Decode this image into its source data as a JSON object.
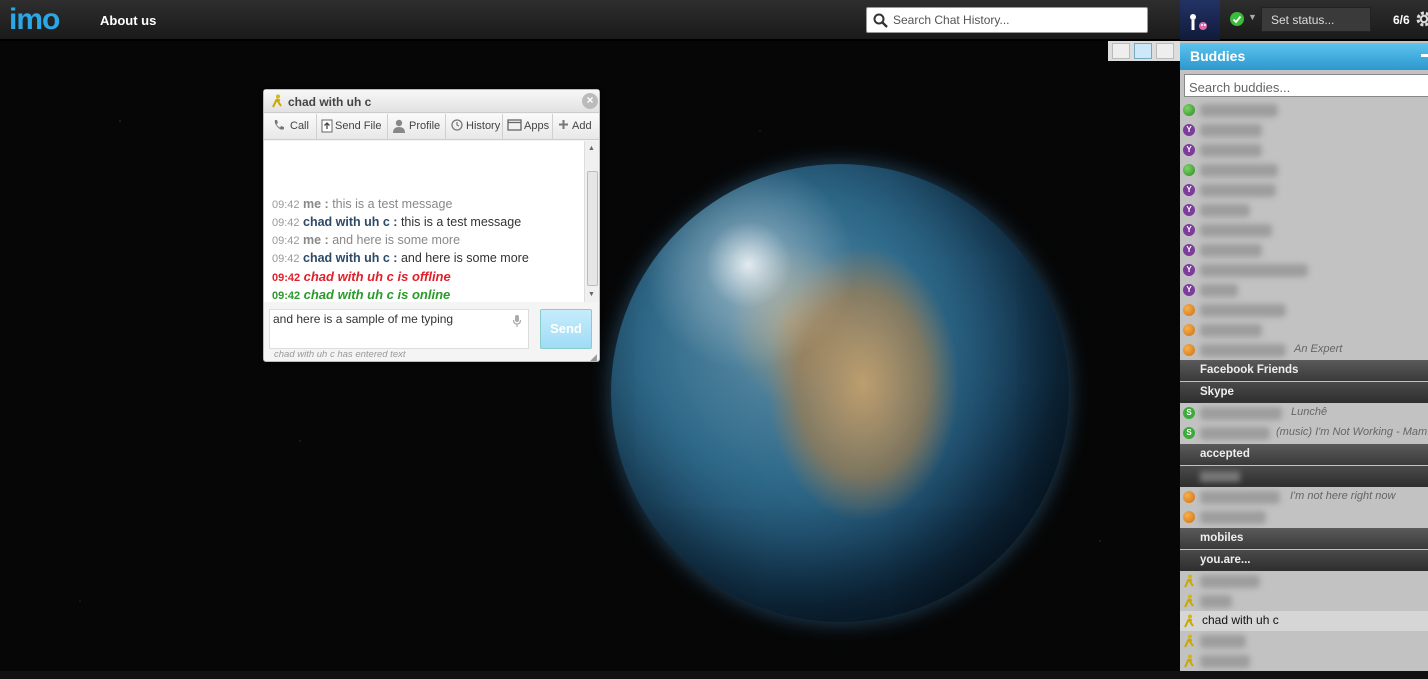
{
  "topbar": {
    "logo": "imo",
    "about": "About us",
    "search_placeholder": "Search Chat History...",
    "status_label": "Set status...",
    "count": "6/6"
  },
  "chat": {
    "title": "chad with uh c",
    "toolbar": {
      "call": "Call",
      "send_file": "Send File",
      "profile": "Profile",
      "history": "History",
      "apps": "Apps",
      "add": "Add"
    },
    "messages": [
      {
        "time": "09:42",
        "sender": "me :",
        "text": "this is a test message"
      },
      {
        "time": "09:42",
        "sender": "chad with uh c :",
        "text": "this is a test message"
      },
      {
        "time": "09:42",
        "sender": "me :",
        "text": "and here is some more"
      },
      {
        "time": "09:42",
        "sender": "chad with uh c :",
        "text": "and here is some more"
      },
      {
        "time": "09:42",
        "text": "chad with uh c is offline"
      },
      {
        "time": "09:42",
        "text": "chad with uh c is online"
      }
    ],
    "input_value": "and here is a sample of me typing",
    "send_label": "Send",
    "typing_note": "chad with uh c has entered text"
  },
  "buddies": {
    "title": "Buddies",
    "search_placeholder": "Search buddies...",
    "status_an_expert": "An Expert",
    "groups": {
      "facebook": "Facebook Friends",
      "skype": "Skype",
      "accepted": "accepted",
      "mobiles": "mobiles",
      "youare": "you.are..."
    },
    "skype_status_1": "Lunchê",
    "skype_status_2": "(music) I'm Not Working - Mam",
    "away_status": "I'm not here right now",
    "selected_buddy": "chad with uh c"
  },
  "colors": {
    "accent": "#2d97cf",
    "offline": "#e0202a",
    "online": "#2a9a2a"
  }
}
